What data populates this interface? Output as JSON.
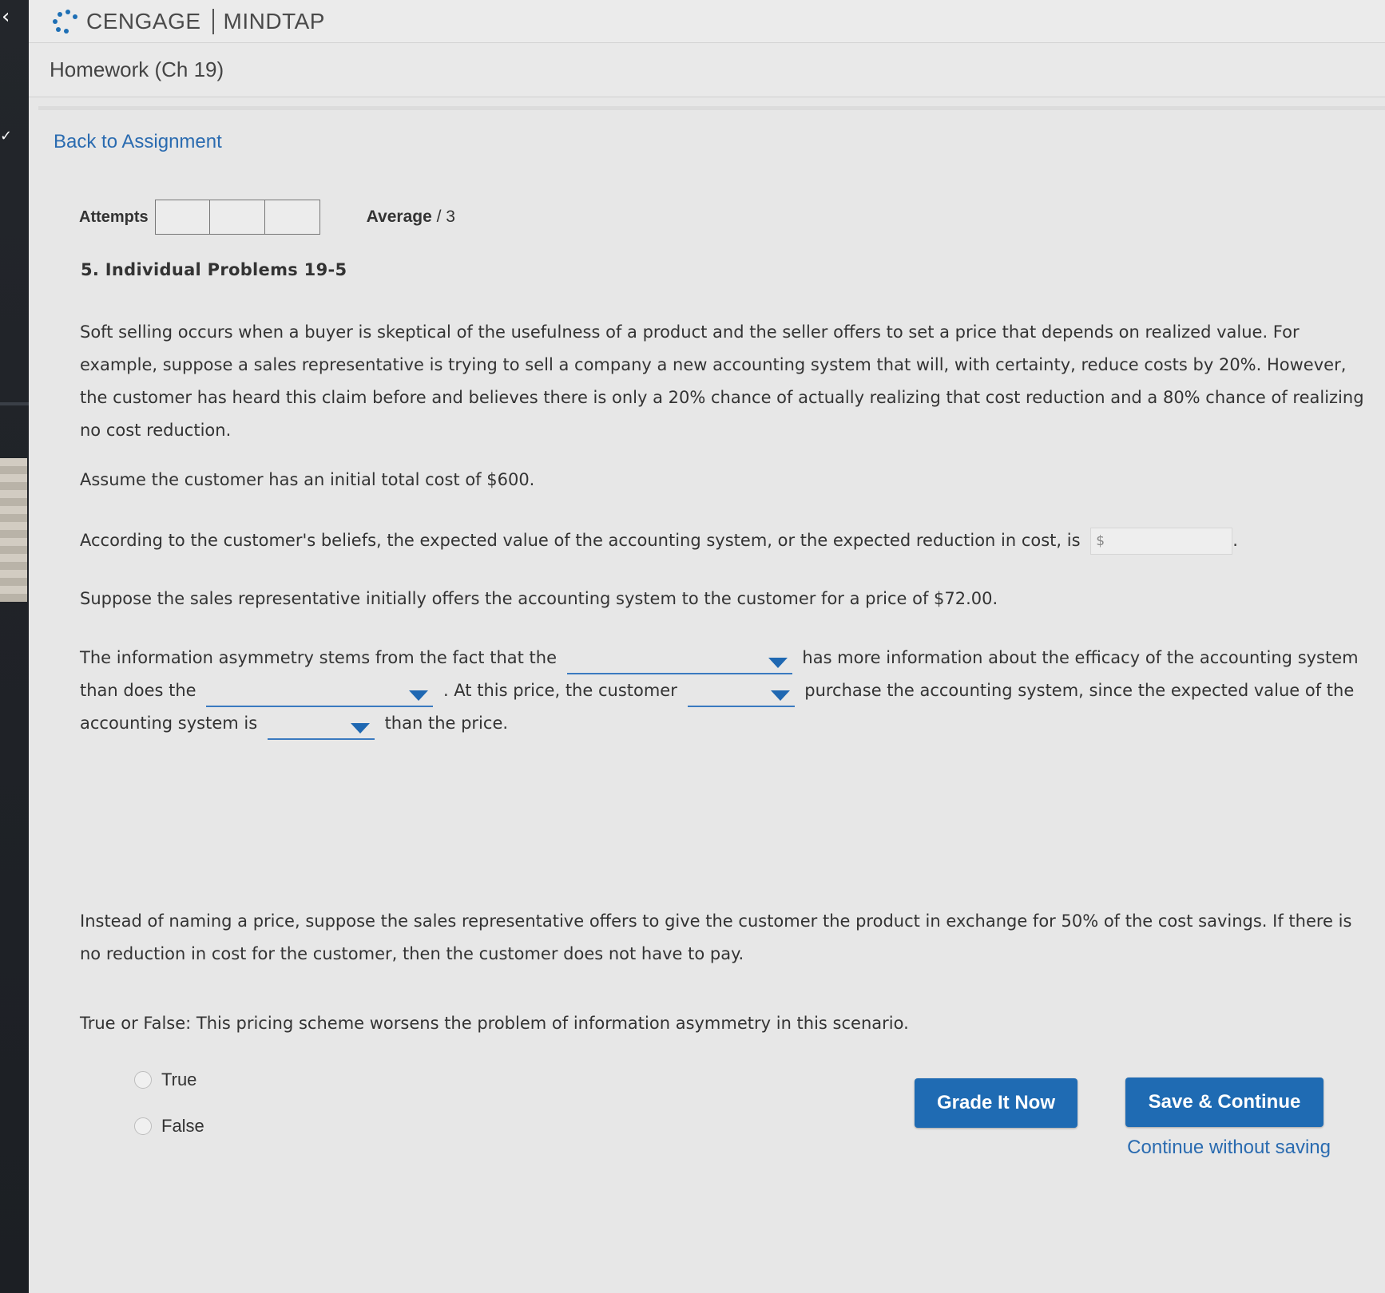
{
  "brand": {
    "name": "CENGAGE",
    "product": "MINDTAP"
  },
  "header": {
    "title": "Homework (Ch 19)"
  },
  "nav": {
    "back_label": "Back to Assignment"
  },
  "attempts": {
    "label": "Attempts",
    "average_prefix": "Average",
    "average_suffix": "/ 3"
  },
  "question": {
    "title": "5. Individual Problems 19-5",
    "intro": "Soft selling occurs when a buyer is skeptical of the usefulness of a product and the seller offers to set a price that depends on realized value. For example, suppose a sales representative is trying to sell a company a new accounting system that will, with certainty, reduce costs by 20%. However, the customer has heard this claim before and believes there is only a 20% chance of actually realizing that cost reduction and a 80% chance of realizing no cost reduction.",
    "assume": "Assume the customer has an initial total cost of $600.",
    "expected_prompt": "According to the customer's beliefs, the expected value of the accounting system, or the expected reduction in cost, is",
    "expected_placeholder": "$",
    "expected_suffix": ".",
    "offer": "Suppose the sales representative initially offers the accounting system to the customer for a price of $72.00.",
    "asym_1": "The information asymmetry stems from the fact that the",
    "asym_2": "has more information about the efficacy of the accounting system than does the",
    "asym_3": ". At this price, the customer",
    "asym_4": "purchase the accounting system, since the expected value of the accounting system is",
    "asym_5": "than the price.",
    "instead": "Instead of naming a price, suppose the sales representative offers to give the customer the product in exchange for 50% of the cost savings. If there is no reduction in cost for the customer, then the customer does not have to pay.",
    "tf_prompt": "True or False: This pricing scheme worsens the problem of information asymmetry in this scenario.",
    "options": [
      "True",
      "False"
    ]
  },
  "actions": {
    "grade_label": "Grade It Now",
    "save_label": "Save & Continue",
    "continue_label": "Continue without saving"
  },
  "colors": {
    "accent": "#1f6bb3",
    "link": "#2a6bb0",
    "background": "#e7e7e7"
  }
}
